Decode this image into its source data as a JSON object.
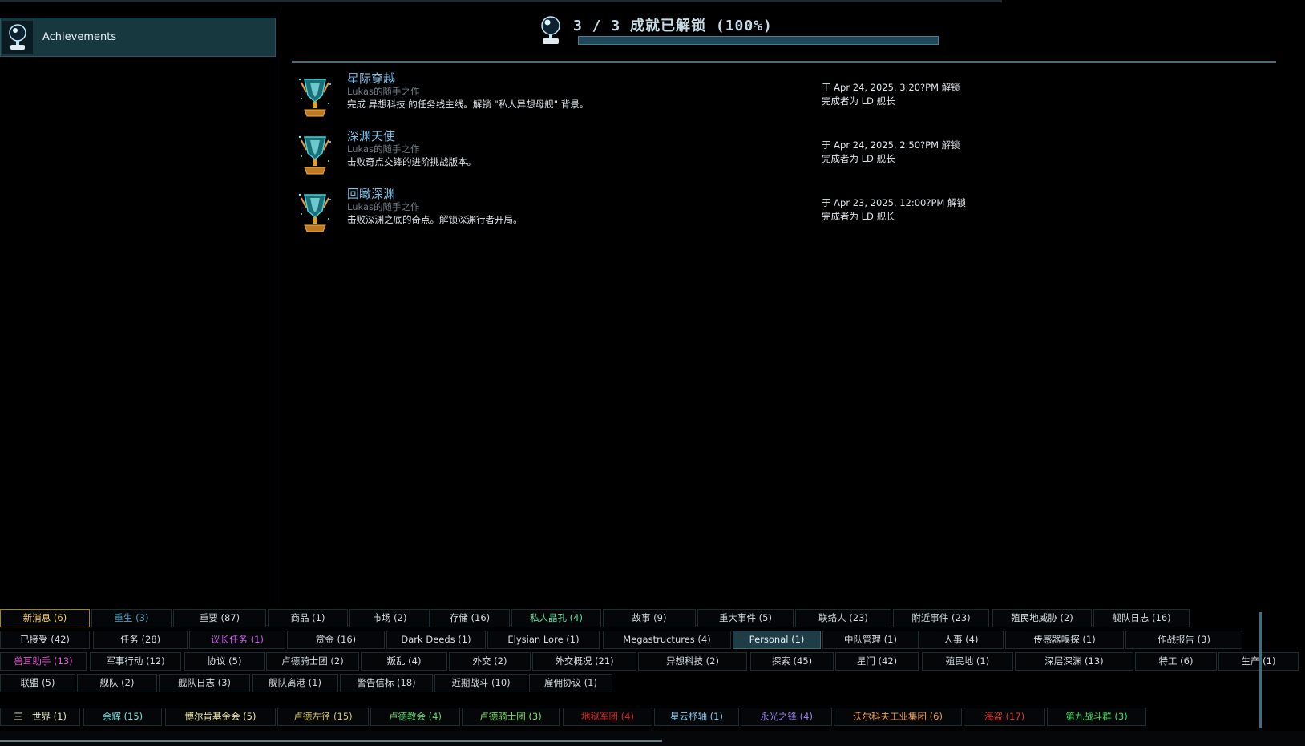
{
  "sidebar": {
    "items": [
      {
        "label": "Achievements",
        "icon": "achievement-globe-icon",
        "selected": true
      }
    ]
  },
  "header": {
    "title": "3 / 3 成就已解锁 (100%)",
    "progress": 1.0,
    "icon": "achievement-globe-icon"
  },
  "achievements": [
    {
      "title": "星际穿越",
      "author": "Lukas的随手之作",
      "description": "完成 异想科技 的任务线主线。解锁 \"私人异想母舰\" 背景。",
      "date": "于 Apr 24, 2025, 3:20?PM 解锁",
      "by": "完成者为 LD 舰长",
      "icon": "trophy-icon"
    },
    {
      "title": "深渊天使",
      "author": "Lukas的随手之作",
      "description": "击败奇点交锋的进阶挑战版本。",
      "date": "于 Apr 24, 2025, 2:50?PM 解锁",
      "by": "完成者为 LD 舰长",
      "icon": "trophy-icon"
    },
    {
      "title": "回瞰深渊",
      "author": "Lukas的随手之作",
      "description": "击败深渊之底的奇点。解锁深渊行者开局。",
      "date": "于 Apr 23, 2025, 12:00?PM 解锁",
      "by": "完成者为 LD 舰长",
      "icon": "trophy-icon"
    }
  ],
  "filters": {
    "row1": [
      {
        "label": "新消息 (6)",
        "color": "#ffd54a"
      },
      {
        "label": "重生 (3)",
        "color": "#4fa3c7"
      },
      {
        "label": "重要 (87)",
        "color": "#d4dde2"
      },
      {
        "label": "商品 (1)",
        "color": "#d4dde2"
      },
      {
        "label": "市场 (2)",
        "color": "#d4dde2"
      },
      {
        "label": "存储 (16)",
        "color": "#d4dde2"
      },
      {
        "label": "私人晶孔 (4)",
        "color": "#5fe0a0"
      },
      {
        "label": "故事 (9)",
        "color": "#d4dde2"
      },
      {
        "label": "重大事件 (5)",
        "color": "#d4dde2"
      },
      {
        "label": "联络人 (23)",
        "color": "#d4dde2"
      },
      {
        "label": "附近事件 (23)",
        "color": "#d4dde2"
      },
      {
        "label": "殖民地威胁 (2)",
        "color": "#d4dde2"
      },
      {
        "label": "舰队日志 (16)",
        "color": "#d4dde2"
      }
    ],
    "row2": [
      {
        "label": "已接受 (42)",
        "color": "#d4dde2"
      },
      {
        "label": "任务 (28)",
        "color": "#d4dde2"
      },
      {
        "label": "议长任务 (1)",
        "color": "#c95cf0"
      },
      {
        "label": "赏金 (16)",
        "color": "#d4dde2"
      },
      {
        "label": "Dark Deeds (1)",
        "color": "#d4dde2"
      },
      {
        "label": "Elysian Lore (1)",
        "color": "#d4dde2"
      },
      {
        "label": "Megastructures (4)",
        "color": "#d4dde2"
      },
      {
        "label": "Personal (1)",
        "color": "#e8eef2"
      },
      {
        "label": "中队管理 (1)",
        "color": "#d4dde2"
      },
      {
        "label": "人事 (4)",
        "color": "#d4dde2"
      },
      {
        "label": "传感器嗅探 (1)",
        "color": "#d4dde2"
      },
      {
        "label": "作战报告 (3)",
        "color": "#d4dde2"
      }
    ],
    "row3": [
      {
        "label": "兽耳助手 (13)",
        "color": "#e860d8"
      },
      {
        "label": "军事行动 (12)",
        "color": "#d4dde2"
      },
      {
        "label": "协议 (5)",
        "color": "#d4dde2"
      },
      {
        "label": "卢德骑士团 (2)",
        "color": "#d4dde2"
      },
      {
        "label": "叛乱 (4)",
        "color": "#d4dde2"
      },
      {
        "label": "外交 (2)",
        "color": "#d4dde2"
      },
      {
        "label": "外交概况 (21)",
        "color": "#d4dde2"
      },
      {
        "label": "异想科技 (2)",
        "color": "#d4dde2"
      },
      {
        "label": "探索 (45)",
        "color": "#d4dde2"
      },
      {
        "label": "星门 (42)",
        "color": "#d4dde2"
      },
      {
        "label": "殖民地 (1)",
        "color": "#d4dde2"
      },
      {
        "label": "深层深渊 (13)",
        "color": "#d4dde2"
      },
      {
        "label": "特工 (6)",
        "color": "#d4dde2"
      },
      {
        "label": "生产 (1)",
        "color": "#d4dde2"
      }
    ],
    "row4": [
      {
        "label": "联盟 (5)",
        "color": "#d4dde2"
      },
      {
        "label": "舰队 (2)",
        "color": "#d4dde2"
      },
      {
        "label": "舰队日志 (3)",
        "color": "#d4dde2"
      },
      {
        "label": "舰队离港 (1)",
        "color": "#d4dde2"
      },
      {
        "label": "警告信标 (18)",
        "color": "#d4dde2"
      },
      {
        "label": "近期战斗 (10)",
        "color": "#d4dde2"
      },
      {
        "label": "雇佣协议 (1)",
        "color": "#d4dde2"
      }
    ],
    "factions": [
      {
        "label": "三一世界 (1)",
        "color": "#e6f0c8"
      },
      {
        "label": "余辉 (15)",
        "color": "#6fe6e6"
      },
      {
        "label": "博尔肯基金会 (5)",
        "color": "#f0e6a0"
      },
      {
        "label": "卢德左径 (15)",
        "color": "#d8c860"
      },
      {
        "label": "卢德教会 (4)",
        "color": "#60d870"
      },
      {
        "label": "卢德骑士团 (3)",
        "color": "#80e060"
      },
      {
        "label": "地狱军团 (4)",
        "color": "#e02020"
      },
      {
        "label": "星云杼轴 (1)",
        "color": "#80c8f0"
      },
      {
        "label": "永光之锋 (4)",
        "color": "#9f7ff0"
      },
      {
        "label": "沃尔科夫工业集团 (6)",
        "color": "#f0a050"
      },
      {
        "label": "海盗 (17)",
        "color": "#e03a2a"
      },
      {
        "label": "第九战斗群 (3)",
        "color": "#40e060"
      }
    ]
  }
}
